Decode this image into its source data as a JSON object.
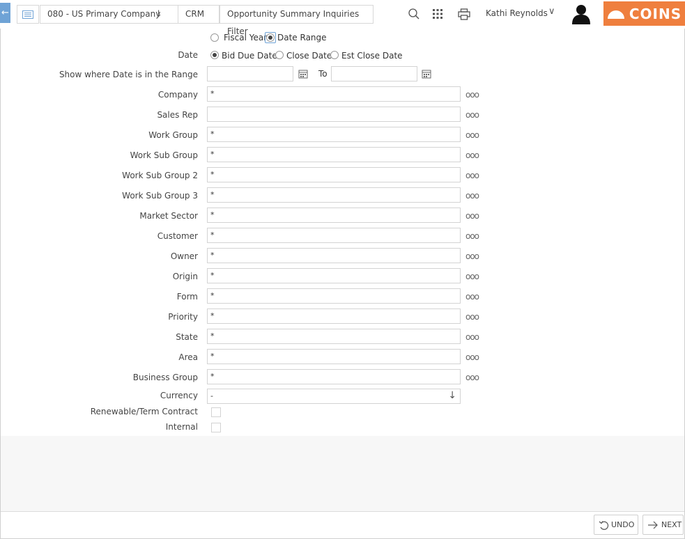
{
  "header": {
    "breadcrumbs": [
      {
        "label": "080 - US Primary Company"
      },
      {
        "label": "CRM"
      },
      {
        "label": "Opportunity Summary Inquiries Filter"
      }
    ],
    "user_name": "Kathi Reynolds",
    "logo_text": "COINS",
    "brand_color": "#ef7f3e"
  },
  "form": {
    "period_options": [
      {
        "label": "Fiscal Year",
        "selected": false
      },
      {
        "label": "Date Range",
        "selected": true
      }
    ],
    "date_label": "Date",
    "date_options": [
      {
        "label": "Bid Due Date",
        "selected": true
      },
      {
        "label": "Close Date",
        "selected": false
      },
      {
        "label": "Est Close Date",
        "selected": false
      }
    ],
    "range_label": "Show where Date is in the Range",
    "range_to_label": "To",
    "range_from": "",
    "range_to": "",
    "fields": [
      {
        "label": "Company",
        "value": "*"
      },
      {
        "label": "Sales Rep",
        "value": ""
      },
      {
        "label": "Work Group",
        "value": "*"
      },
      {
        "label": "Work Sub Group",
        "value": "*"
      },
      {
        "label": "Work Sub Group 2",
        "value": "*"
      },
      {
        "label": "Work Sub Group 3",
        "value": "*"
      },
      {
        "label": "Market Sector",
        "value": "*"
      },
      {
        "label": "Customer",
        "value": "*"
      },
      {
        "label": "Owner",
        "value": "*"
      },
      {
        "label": "Origin",
        "value": "*"
      },
      {
        "label": "Form",
        "value": "*"
      },
      {
        "label": "Priority",
        "value": "*"
      },
      {
        "label": "State",
        "value": "*"
      },
      {
        "label": "Area",
        "value": "*"
      },
      {
        "label": "Business Group",
        "value": "*"
      }
    ],
    "lookup_glyph": "ooo",
    "currency_label": "Currency",
    "currency_value": "-",
    "renewable_label": "Renewable/Term Contract",
    "internal_label": "Internal"
  },
  "footer": {
    "undo_label": "UNDO",
    "next_label": "NEXT"
  }
}
